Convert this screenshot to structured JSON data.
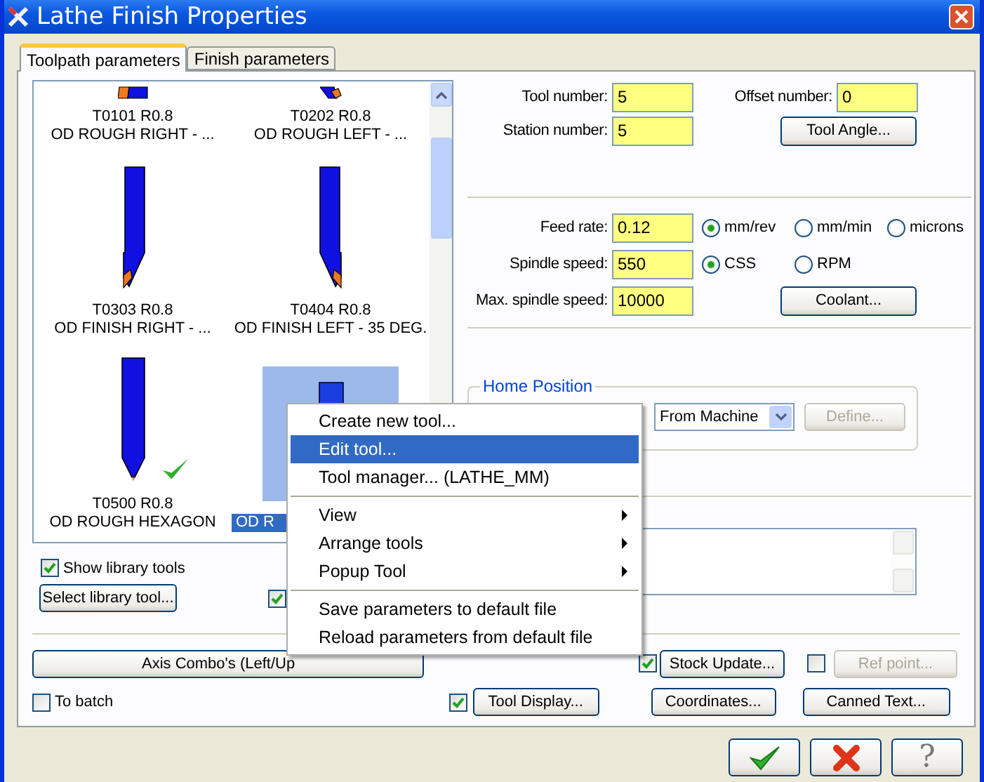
{
  "window": {
    "title": "Lathe Finish Properties"
  },
  "tabs": [
    {
      "label": "Toolpath parameters",
      "selected": true
    },
    {
      "label": "Finish parameters",
      "selected": false
    }
  ],
  "tool_list": {
    "items": [
      {
        "kind": "rough_right",
        "lines": [
          "T0101 R0.8",
          "OD ROUGH RIGHT - ..."
        ],
        "selected": false,
        "checked": false
      },
      {
        "kind": "rough_left",
        "lines": [
          "T0202 R0.8",
          "OD ROUGH LEFT - ..."
        ],
        "selected": false,
        "checked": false
      },
      {
        "kind": "finish_right",
        "lines": [
          "T0303 R0.8",
          "OD FINISH RIGHT - ..."
        ],
        "selected": false,
        "checked": false
      },
      {
        "kind": "finish_left",
        "lines": [
          "T0404 R0.8",
          "OD FINISH LEFT - 35 DEG."
        ],
        "selected": false,
        "checked": false
      },
      {
        "kind": "hexagon",
        "lines": [
          "T0500 R0.8",
          "OD ROUGH HEXAGON"
        ],
        "selected": false,
        "checked": true
      },
      {
        "kind": "plain",
        "lines": [
          "OD R"
        ],
        "selected": true,
        "checked": false
      }
    ]
  },
  "show_library_tools": {
    "label": "Show library tools",
    "checked": true
  },
  "select_library_button": "Select library tool...",
  "covered_checkbox": {
    "checked": true
  },
  "tool_number": {
    "label": "Tool number:",
    "value": "5"
  },
  "offset_number": {
    "label": "Offset number:",
    "value": "0"
  },
  "station_number": {
    "label": "Station number:",
    "value": "5"
  },
  "tool_angle_button": "Tool Angle...",
  "feed_rate": {
    "label": "Feed rate:",
    "value": "0.12",
    "options": [
      {
        "label": "mm/rev",
        "selected": true
      },
      {
        "label": "mm/min",
        "selected": false
      },
      {
        "label": "microns",
        "selected": false
      }
    ]
  },
  "spindle_speed": {
    "label": "Spindle speed:",
    "value": "550",
    "options": [
      {
        "label": "CSS",
        "selected": true
      },
      {
        "label": "RPM",
        "selected": false
      }
    ]
  },
  "max_spindle_speed": {
    "label": "Max. spindle speed:",
    "value": "10000"
  },
  "coolant_button": "Coolant...",
  "home_position": {
    "title": "Home Position",
    "dropdown": "From Machine",
    "define_button": {
      "label": "Define...",
      "disabled": true
    }
  },
  "axis_combo_button": "Axis Combo's (Left/Up",
  "stock_update": {
    "checked": true,
    "label": "Stock Update..."
  },
  "ref_point": {
    "checked": false,
    "label": "Ref point...",
    "disabled": true
  },
  "to_batch": {
    "label": "To batch",
    "checked": false
  },
  "tool_display": {
    "checked": true,
    "label": "Tool Display..."
  },
  "coordinates_button": "Coordinates...",
  "canned_text_button": "Canned Text...",
  "context_menu": {
    "groups": [
      [
        {
          "label": "Create new tool...",
          "selected": false,
          "submenu": false
        },
        {
          "label": "Edit tool...",
          "selected": true,
          "submenu": false
        },
        {
          "label": "Tool manager... (LATHE_MM)",
          "selected": false,
          "submenu": false
        }
      ],
      [
        {
          "label": "View",
          "selected": false,
          "submenu": true
        },
        {
          "label": "Arrange tools",
          "selected": false,
          "submenu": true
        },
        {
          "label": "Popup Tool",
          "selected": false,
          "submenu": true
        }
      ],
      [
        {
          "label": "Save parameters to default file",
          "selected": false,
          "submenu": false
        },
        {
          "label": "Reload parameters from default file",
          "selected": false,
          "submenu": false
        }
      ]
    ]
  },
  "dialog_buttons": [
    {
      "kind": "ok"
    },
    {
      "kind": "cancel"
    },
    {
      "kind": "help",
      "label": "?"
    }
  ]
}
